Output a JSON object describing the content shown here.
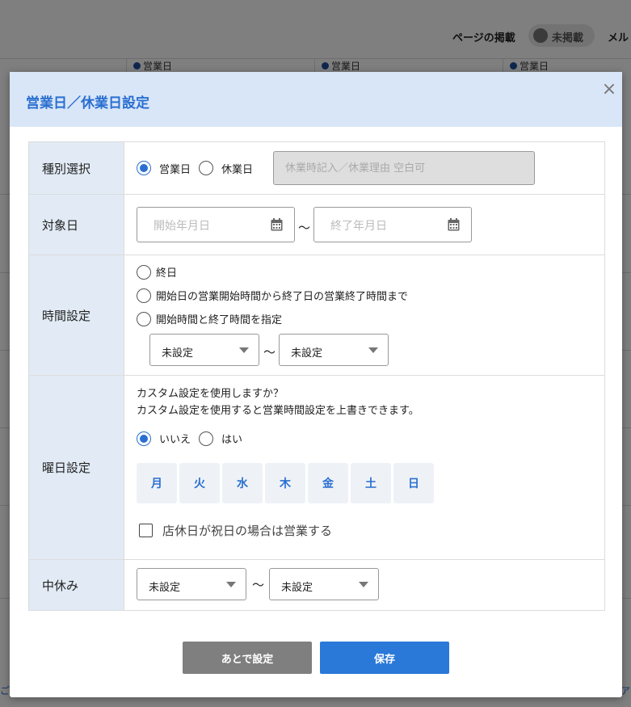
{
  "background": {
    "publish_label": "ページの掲載",
    "publish_toggle_label": "未掲載",
    "mail_label": "メル",
    "column_headers": [
      "営業日",
      "営業日",
      "営業日"
    ],
    "left_edge_text": "ご",
    "right_edge_text": "ア"
  },
  "modal": {
    "title": "営業日／休業日設定",
    "close_symbol": "×"
  },
  "form": {
    "type_row": {
      "label": "種別選択",
      "options": [
        "営業日",
        "休業日"
      ],
      "selected": "営業日",
      "reason_placeholder": "休業時記入／休業理由 空白可"
    },
    "date_row": {
      "label": "対象日",
      "start_placeholder": "開始年月日",
      "end_placeholder": "終了年月日",
      "separator": "～"
    },
    "time_row": {
      "label": "時間設定",
      "options": [
        "終日",
        "開始日の営業開始時間から終了日の営業終了時間まで",
        "開始時間と終了時間を指定"
      ],
      "start_time": "未設定",
      "end_time": "未設定",
      "separator": "～"
    },
    "weekday_row": {
      "label": "曜日設定",
      "question_line1": "カスタム設定を使用しますか？",
      "question_line2": "カスタム設定を使用すると営業時間設定を上書きできます。",
      "options": [
        "いいえ",
        "はい"
      ],
      "selected": "いいえ",
      "days": [
        "月",
        "火",
        "水",
        "木",
        "金",
        "土",
        "日"
      ],
      "holiday_checkbox_label": "店休日が祝日の場合は営業する",
      "holiday_checked": false
    },
    "break_row": {
      "label": "中休み",
      "start": "未設定",
      "end": "未設定",
      "separator": "～"
    }
  },
  "buttons": {
    "later_label": "あとで設定",
    "save_label": "保存"
  },
  "colors": {
    "accent": "#2a6fd0",
    "header_bg": "#d9e6f8",
    "label_bg": "#e2ebf5",
    "later_button": "#7f7f7f",
    "save_button": "#2a78d8"
  },
  "icons": {
    "close": "close-icon",
    "calendar": "calendar-icon",
    "dropdown": "chevron-down-icon"
  }
}
